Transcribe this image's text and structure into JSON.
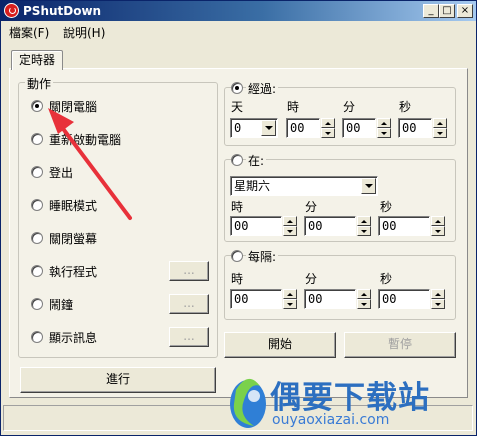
{
  "window": {
    "title": "PShutDown"
  },
  "title_buttons": {
    "minimize": "_",
    "maximize": "□",
    "close": "×"
  },
  "menu": [
    "檔案(F)",
    "說明(H)"
  ],
  "tab": "定時器",
  "action_group": {
    "title": "動作",
    "options": [
      {
        "label": "關閉電腦",
        "selected": true
      },
      {
        "label": "重新啟動電腦",
        "selected": false
      },
      {
        "label": "登出",
        "selected": false
      },
      {
        "label": "睡眠模式",
        "selected": false
      },
      {
        "label": "關閉螢幕",
        "selected": false
      },
      {
        "label": "執行程式",
        "selected": false
      },
      {
        "label": "鬧鐘",
        "selected": false
      },
      {
        "label": "顯示訊息",
        "selected": false
      }
    ],
    "browse_label": "..."
  },
  "run_button": "進行",
  "after": {
    "title": "經過:",
    "selected": true,
    "labels": [
      "天",
      "時",
      "分",
      "秒"
    ],
    "values": [
      "0",
      "00",
      "00",
      "00"
    ]
  },
  "at": {
    "title": "在:",
    "selected": false,
    "weekday": "星期六",
    "labels": [
      "時",
      "分",
      "秒"
    ],
    "values": [
      "00",
      "00",
      "00"
    ]
  },
  "every": {
    "title": "每隔:",
    "selected": false,
    "labels": [
      "時",
      "分",
      "秒"
    ],
    "values": [
      "00",
      "00",
      "00"
    ]
  },
  "start_button": "開始",
  "pause_button": "暫停",
  "watermark": {
    "text": "偶要下载站",
    "url": "ouyaoxiazai.com"
  },
  "colors": {
    "annotation_arrow": "#e8313a",
    "title_bar": "#0a246a"
  }
}
